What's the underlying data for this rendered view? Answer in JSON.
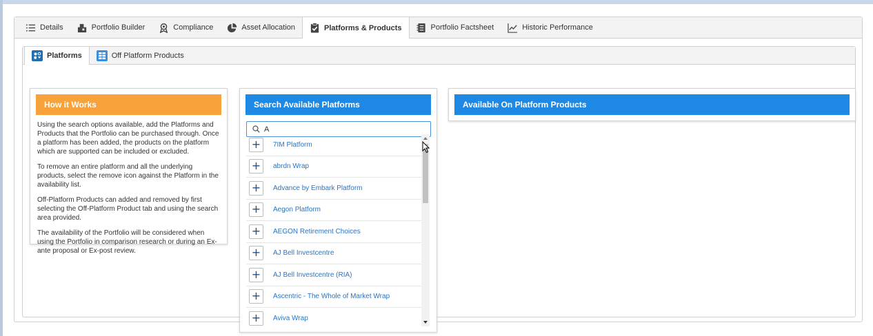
{
  "main_tabs": [
    {
      "label": "Details",
      "icon": "list-icon"
    },
    {
      "label": "Portfolio Builder",
      "icon": "builder-icon"
    },
    {
      "label": "Compliance",
      "icon": "award-icon"
    },
    {
      "label": "Asset Allocation",
      "icon": "pie-chart-icon"
    },
    {
      "label": "Platforms & Products",
      "icon": "clipboard-check-icon"
    },
    {
      "label": "Portfolio Factsheet",
      "icon": "factsheet-icon"
    },
    {
      "label": "Historic Performance",
      "icon": "line-chart-icon"
    }
  ],
  "active_main_tab": "Platforms & Products",
  "sub_tabs": [
    {
      "label": "Platforms",
      "icon": "platforms-icon"
    },
    {
      "label": "Off Platform Products",
      "icon": "grid-icon"
    }
  ],
  "how_it_works": {
    "title": "How it Works",
    "paragraphs": [
      "Using the search options available, add the Platforms and Products that the Portfolio can be purchased through. Once a platform has been added, the products on the platform which are supported can be included or excluded.",
      "To remove an entire platform and all the underlying products, select the remove icon against the Platform in the availability list.",
      "Off-Platform Products can added and removed by first selecting the Off-Platform Product tab and using the search area provided.",
      "The availability of the Portfolio will be considered when using the Portfolio in comparison research or during an Ex-ante proposal or Ex-post review."
    ]
  },
  "search": {
    "title": "Search Available Platforms",
    "value": "A",
    "results": [
      "7IM Platform",
      "abrdn Wrap",
      "Advance by Embark Platform",
      "Aegon Platform",
      "AEGON Retirement Choices",
      "AJ Bell Investcentre",
      "AJ Bell Investcentre (RIA)",
      "Ascentric - The Whole of Market Wrap",
      "Aviva Wrap"
    ]
  },
  "available": {
    "title": "Available On Platform Products"
  },
  "colors": {
    "orange_header": "#f7a23b",
    "blue_header": "#1e88e5",
    "link_blue": "#2a74c2",
    "plus_blue": "#1c4f8a"
  }
}
